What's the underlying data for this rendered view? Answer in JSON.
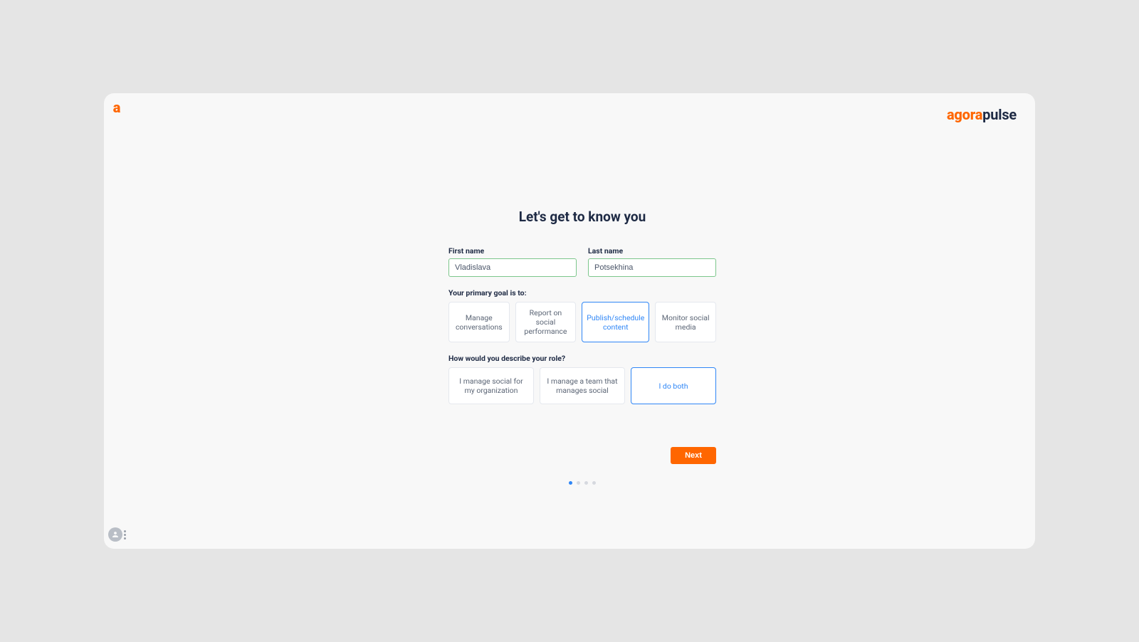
{
  "brand": {
    "mark": "a",
    "word_orange": "agora",
    "word_navy": "pulse"
  },
  "headline": "Let's get to know you",
  "fields": {
    "first_name": {
      "label": "First name",
      "value": "Vladislava"
    },
    "last_name": {
      "label": "Last name",
      "value": "Potsekhina"
    }
  },
  "goal": {
    "label": "Your primary goal is to:",
    "options": [
      "Manage conversations",
      "Report on social performance",
      "Publish/schedule content",
      "Monitor social media"
    ],
    "selected_index": 2
  },
  "role": {
    "label": "How would you describe your role?",
    "options": [
      "I manage social for my organization",
      "I manage a team that manages social",
      "I do both"
    ],
    "selected_index": 2
  },
  "next_label": "Next",
  "step": {
    "current": 1,
    "total": 4
  }
}
